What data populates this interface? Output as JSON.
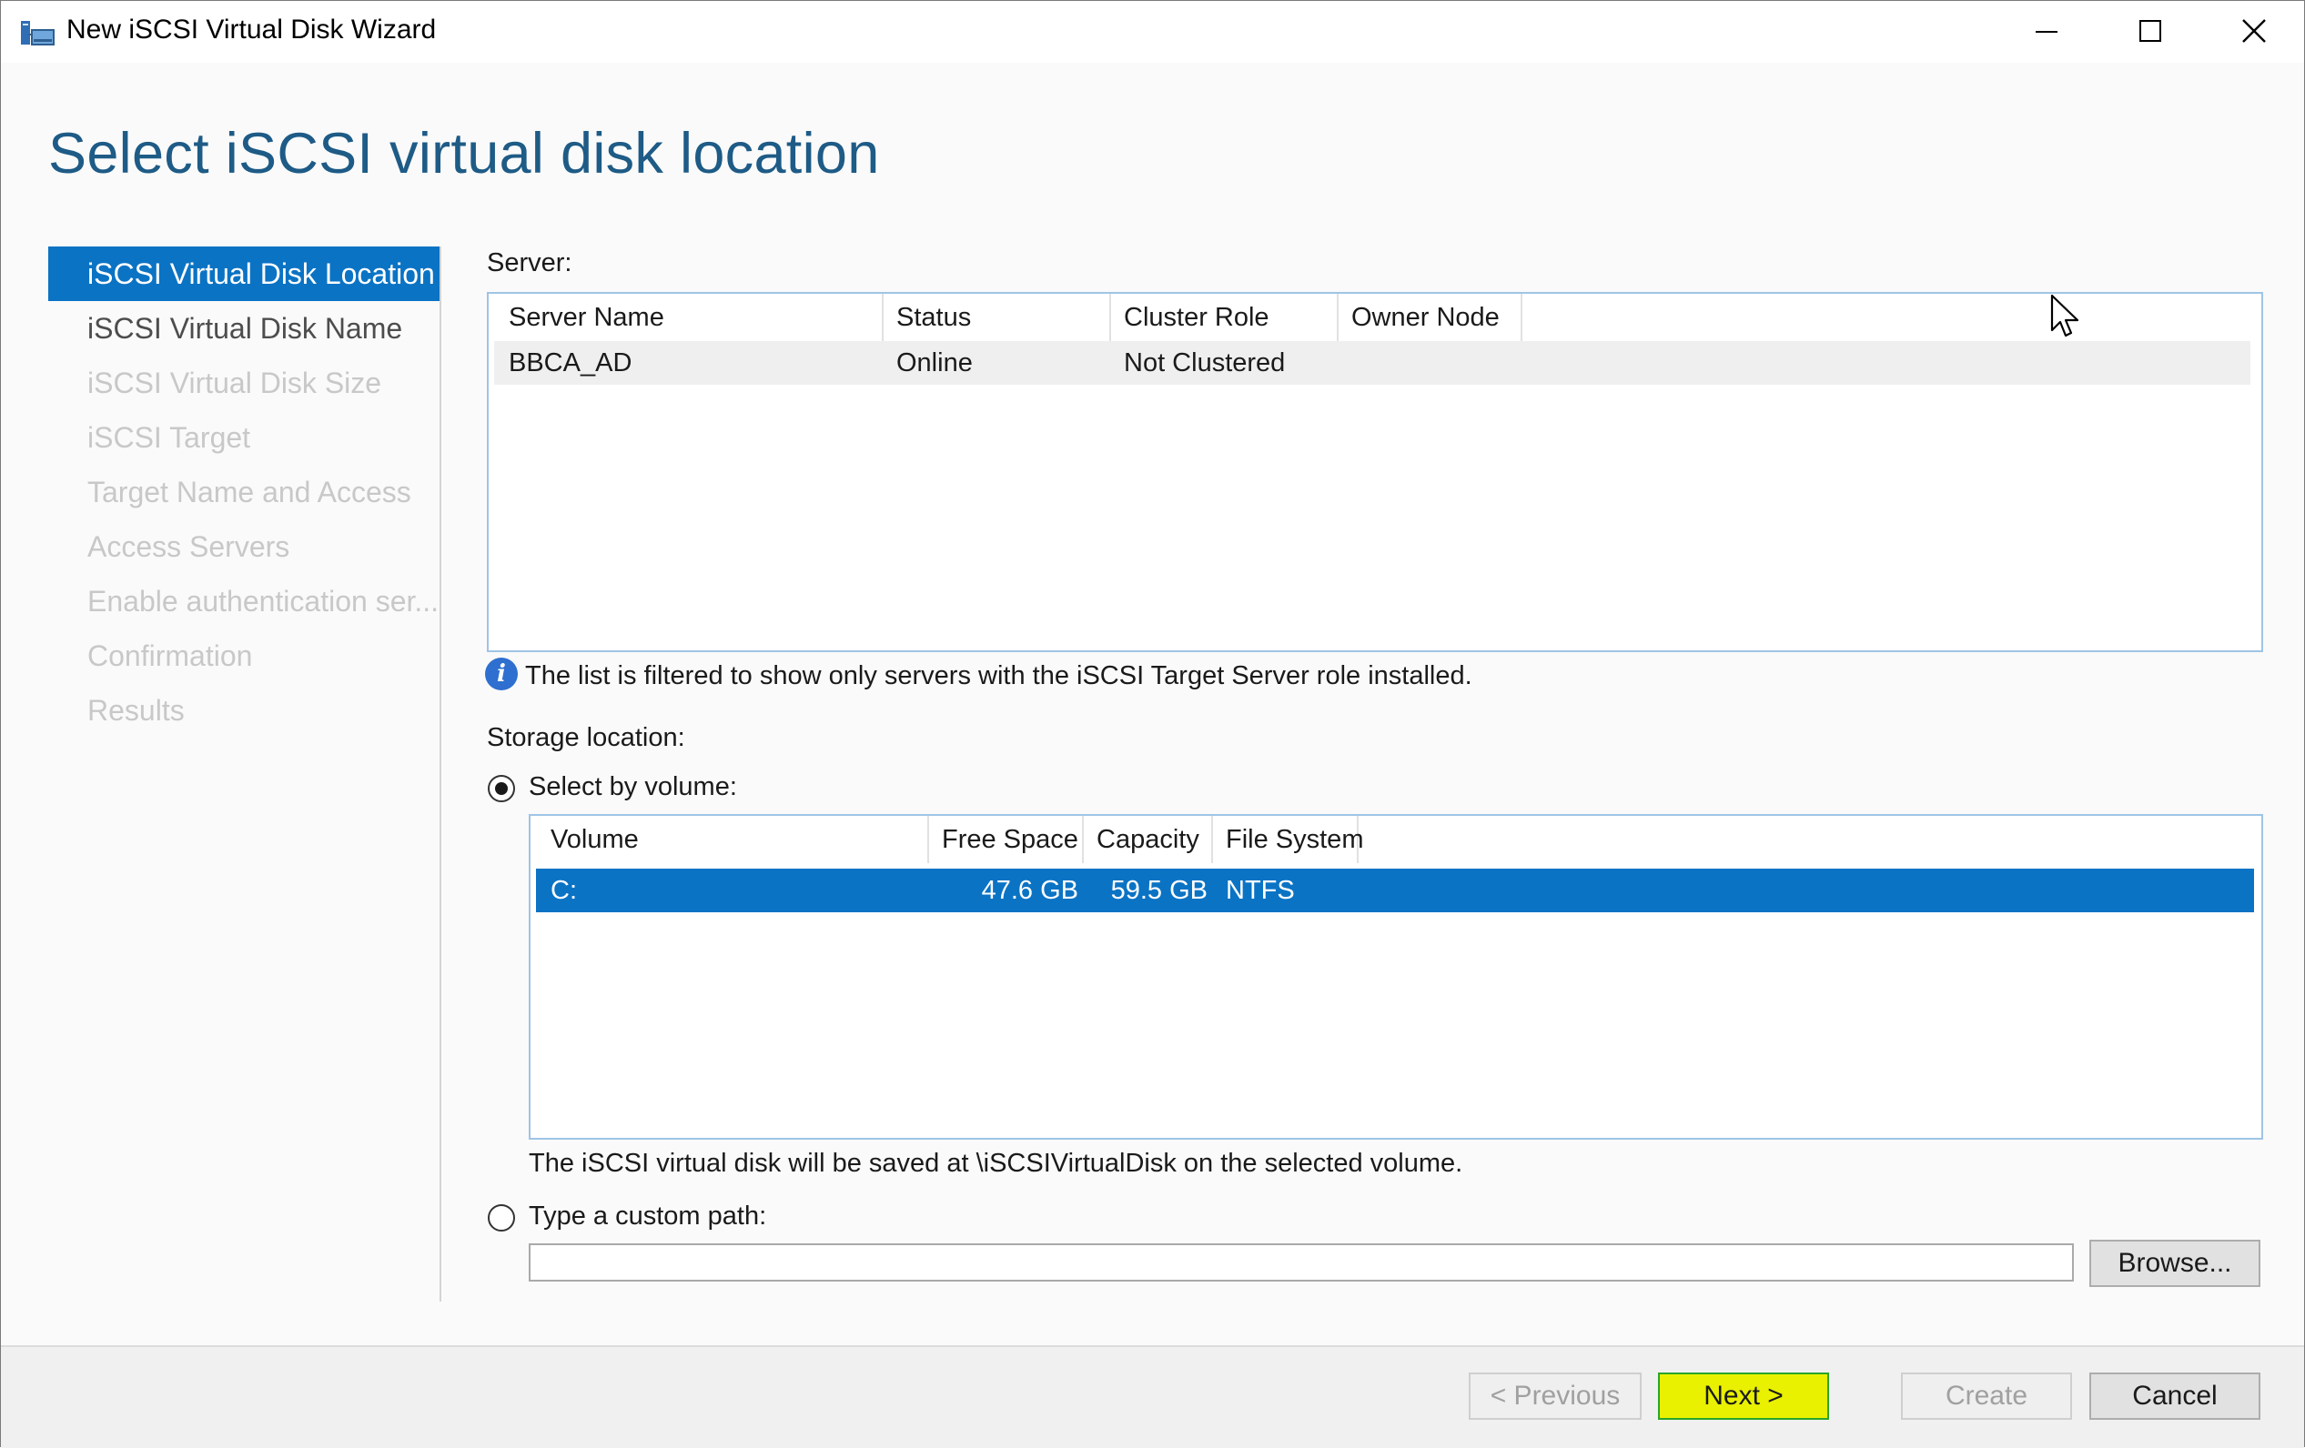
{
  "window": {
    "title": "New iSCSI Virtual Disk Wizard",
    "icon": "wizard-disk-icon",
    "controls": [
      "minimize-icon",
      "maximize-icon",
      "close-icon"
    ]
  },
  "page": {
    "heading": "Select iSCSI virtual disk location"
  },
  "nav": {
    "items": [
      {
        "label": "iSCSI Virtual Disk Location",
        "state": "selected"
      },
      {
        "label": "iSCSI Virtual Disk Name",
        "state": "enabled"
      },
      {
        "label": "iSCSI Virtual Disk Size",
        "state": "disabled"
      },
      {
        "label": "iSCSI Target",
        "state": "disabled"
      },
      {
        "label": "Target Name and Access",
        "state": "disabled"
      },
      {
        "label": "Access Servers",
        "state": "disabled"
      },
      {
        "label": "Enable authentication ser...",
        "state": "disabled"
      },
      {
        "label": "Confirmation",
        "state": "disabled"
      },
      {
        "label": "Results",
        "state": "disabled"
      }
    ]
  },
  "server_section": {
    "label": "Server:",
    "columns": [
      "Server Name",
      "Status",
      "Cluster Role",
      "Owner Node"
    ],
    "rows": [
      {
        "server_name": "BBCA_AD",
        "status": "Online",
        "cluster_role": "Not Clustered",
        "owner_node": ""
      }
    ],
    "info_text": "The list is filtered to show only servers with the iSCSI Target Server role installed."
  },
  "storage_section": {
    "label": "Storage location:",
    "select_by_volume": {
      "label": "Select by volume:",
      "checked": true
    },
    "columns": [
      "Volume",
      "Free Space",
      "Capacity",
      "File System"
    ],
    "rows": [
      {
        "volume": "C:",
        "free_space": "47.6 GB",
        "capacity": "59.5 GB",
        "file_system": "NTFS"
      }
    ],
    "save_note": "The iSCSI virtual disk will be saved at \\iSCSIVirtualDisk on the selected volume.",
    "custom_path": {
      "label": "Type a custom path:",
      "checked": false,
      "value": ""
    },
    "browse_label": "Browse..."
  },
  "footer": {
    "previous_label": "< Previous",
    "next_label": "Next >",
    "create_label": "Create",
    "cancel_label": "Cancel"
  },
  "colors": {
    "heading": "#1e5b86",
    "selection": "#0b73c4",
    "highlight": "#e9f000"
  }
}
